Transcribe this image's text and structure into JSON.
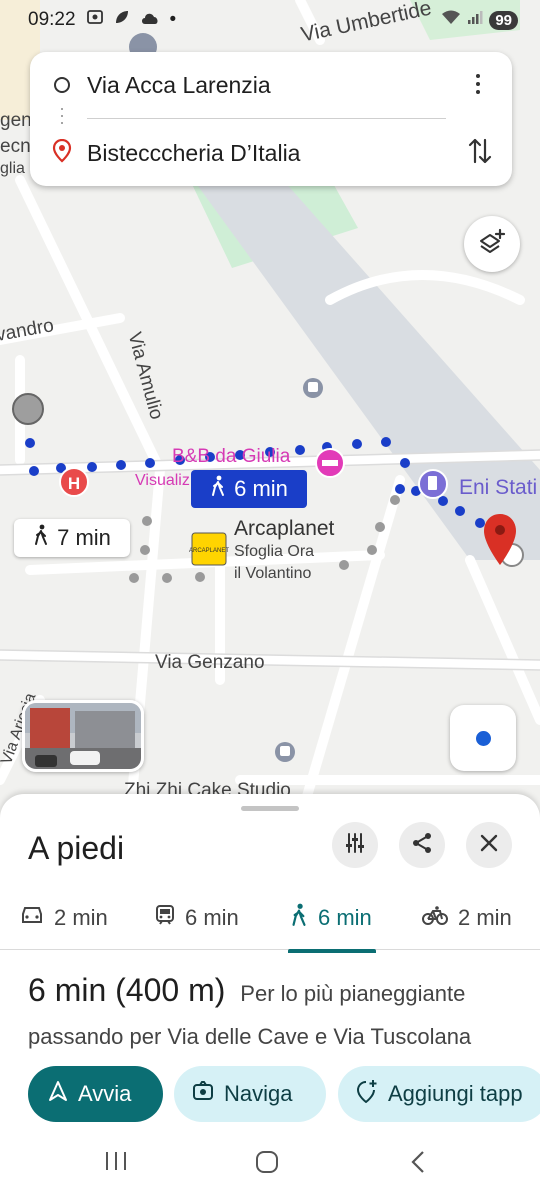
{
  "status_bar": {
    "time": "09:22",
    "battery": "99"
  },
  "route": {
    "origin": "Via Acca Larenzia",
    "destination": "Bistecccheria D’Italia"
  },
  "map": {
    "streets": {
      "umbertide": "Via Umbertide",
      "amulio": "Via Amulio",
      "genzano": "Via Genzano",
      "ariccia": "Via Ariccia",
      "evandro": "vandro"
    },
    "pois": {
      "bb": "B&B da Giulia",
      "visualiz": "Visualiz",
      "arcaplanet": "Arcaplanet",
      "sfoglia": "Sfoglia Ora",
      "volantino": "il Volantino",
      "eni": "Eni Stati",
      "zhizhi": "Zhi Zhi Cake Studio",
      "edge_1": "gen",
      "edge_2": "ecn",
      "edge_3": "glia"
    },
    "route_time_badge": "6 min",
    "alt_time_badge": "7 min"
  },
  "sheet": {
    "title": "A piedi",
    "modes": [
      {
        "icon": "car-icon",
        "label": "2 min"
      },
      {
        "icon": "train-icon",
        "label": "6 min"
      },
      {
        "icon": "walk-icon",
        "label": "6 min"
      },
      {
        "icon": "bike-icon",
        "label": "2 min"
      }
    ],
    "summary_time": "6 min",
    "summary_distance": "(400 m)",
    "summary_note": "Per lo più pianeggiante",
    "via_text": "passando per Via delle Cave e Via Tuscolana",
    "actions": {
      "start": "Avvia",
      "navigate": "Naviga",
      "add_stop": "Aggiungi tapp"
    }
  },
  "colors": {
    "route_blue": "#1a3ec8",
    "accent_teal": "#0b6e73",
    "chip_bg": "#d6f1f6",
    "destination_red": "#d93025"
  }
}
